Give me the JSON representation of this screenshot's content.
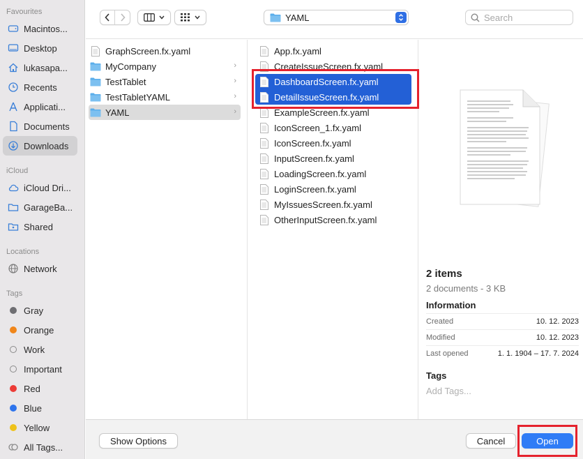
{
  "sidebar": {
    "sections": {
      "favourites": "Favourites",
      "icloud": "iCloud",
      "locations": "Locations",
      "tags": "Tags"
    },
    "favourites": [
      {
        "label": "Macintos...",
        "icon": "hard-drive-icon"
      },
      {
        "label": "Desktop",
        "icon": "desktop-icon"
      },
      {
        "label": "lukasapa...",
        "icon": "home-icon"
      },
      {
        "label": "Recents",
        "icon": "clock-icon"
      },
      {
        "label": "Applicati...",
        "icon": "applications-icon"
      },
      {
        "label": "Documents",
        "icon": "document-icon"
      },
      {
        "label": "Downloads",
        "icon": "download-icon",
        "selected": true
      }
    ],
    "icloud": [
      {
        "label": "iCloud Dri...",
        "icon": "cloud-icon"
      },
      {
        "label": "GarageBa...",
        "icon": "folder-icon"
      },
      {
        "label": "Shared",
        "icon": "shared-folder-icon"
      }
    ],
    "locations": [
      {
        "label": "Network",
        "icon": "network-icon"
      }
    ],
    "tags": [
      {
        "label": "Gray",
        "color": "#6e6e72"
      },
      {
        "label": "Orange",
        "color": "#f0861a"
      },
      {
        "label": "Work",
        "color": ""
      },
      {
        "label": "Important",
        "color": ""
      },
      {
        "label": "Red",
        "color": "#ec3b36"
      },
      {
        "label": "Blue",
        "color": "#2e74ec"
      },
      {
        "label": "Yellow",
        "color": "#eec21a"
      },
      {
        "label": "All Tags...",
        "color": ""
      }
    ]
  },
  "toolbar": {
    "path_label": "YAML",
    "search_placeholder": "Search"
  },
  "column1": [
    {
      "label": "GraphScreen.fx.yaml",
      "type": "file"
    },
    {
      "label": "MyCompany",
      "type": "folder"
    },
    {
      "label": "TestTablet",
      "type": "folder"
    },
    {
      "label": "TestTabletYAML",
      "type": "folder"
    },
    {
      "label": "YAML",
      "type": "folder",
      "selected": true
    }
  ],
  "column2": [
    {
      "label": "App.fx.yaml",
      "selected": false
    },
    {
      "label": "CreateIssueScreen.fx.yaml",
      "selected": false
    },
    {
      "label": "DashboardScreen.fx.yaml",
      "selected": true
    },
    {
      "label": "DetailIssueScreen.fx.yaml",
      "selected": true
    },
    {
      "label": "ExampleScreen.fx.yaml",
      "selected": false
    },
    {
      "label": "IconScreen_1.fx.yaml",
      "selected": false
    },
    {
      "label": "IconScreen.fx.yaml",
      "selected": false
    },
    {
      "label": "InputScreen.fx.yaml",
      "selected": false
    },
    {
      "label": "LoadingScreen.fx.yaml",
      "selected": false
    },
    {
      "label": "LoginScreen.fx.yaml",
      "selected": false
    },
    {
      "label": "MyIssuesScreen.fx.yaml",
      "selected": false
    },
    {
      "label": "OtherInputScreen.fx.yaml",
      "selected": false
    }
  ],
  "preview": {
    "title": "2 items",
    "subtitle": "2 documents - 3 KB",
    "info_heading": "Information",
    "info": [
      {
        "key": "Created",
        "value": "10. 12. 2023"
      },
      {
        "key": "Modified",
        "value": "10. 12. 2023"
      },
      {
        "key": "Last opened",
        "value": "1. 1. 1904 – 17. 7. 2024"
      }
    ],
    "tags_heading": "Tags",
    "tags_placeholder": "Add Tags..."
  },
  "footer": {
    "show_options": "Show Options",
    "cancel": "Cancel",
    "open": "Open"
  },
  "colors": {
    "selection_blue": "#2360d6",
    "primary_button": "#2f7cf6",
    "annotation_red": "#e5222d",
    "folder_blue": "#5aaeeb"
  }
}
